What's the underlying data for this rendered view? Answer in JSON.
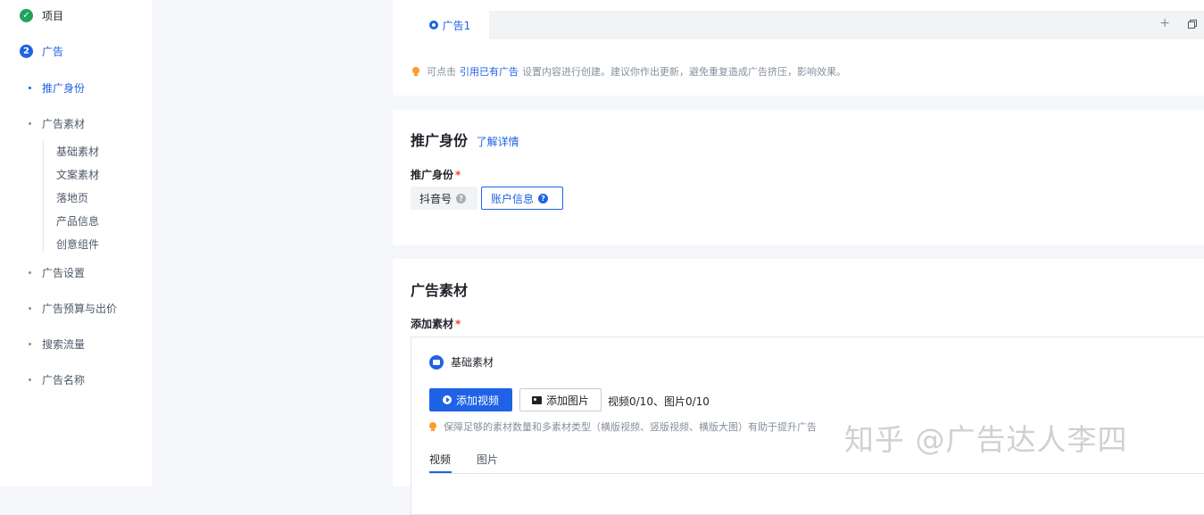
{
  "sidebar": {
    "steps": [
      {
        "label": "项目",
        "badge": "✓",
        "state": "done"
      },
      {
        "label": "广告",
        "badge": "2",
        "state": "current"
      }
    ],
    "nav": [
      {
        "label": "推广身份",
        "active": true
      },
      {
        "label": "广告素材",
        "active": false
      },
      {
        "label": "广告设置",
        "active": false
      },
      {
        "label": "广告预算与出价",
        "active": false
      },
      {
        "label": "搜索流量",
        "active": false
      },
      {
        "label": "广告名称",
        "active": false
      }
    ],
    "sub_items": [
      "基础素材",
      "文案素材",
      "落地页",
      "产品信息",
      "创意组件"
    ]
  },
  "ad_tabs": {
    "tabs": [
      {
        "label": "广告1"
      }
    ],
    "add_icon": "plus-icon",
    "copy_icon": "copy-icon",
    "tip_prefix": "可点击",
    "tip_link": "引用已有广告",
    "tip_suffix": "设置内容进行创建。建议你作出更新，避免重复造成广告挤压，影响效果。"
  },
  "identity": {
    "title": "推广身份",
    "learn_more": "了解详情",
    "field_label": "推广身份",
    "options": [
      {
        "label": "抖音号",
        "selected": false
      },
      {
        "label": "账户信息",
        "selected": true
      }
    ]
  },
  "material": {
    "title": "广告素材",
    "field_label": "添加素材",
    "basic_label": "基础素材",
    "add_video": "添加视频",
    "add_image": "添加图片",
    "count": "视频0/10、图片0/10",
    "tip": "保障足够的素材数量和多素材类型（横版视频、竖版视频、横版大图）有助于提升广告",
    "tabs": [
      {
        "label": "视频",
        "active": true
      },
      {
        "label": "图片",
        "active": false
      }
    ]
  },
  "watermark": "知乎 @广告达人李四",
  "colors": {
    "accent": "#1e62e6",
    "success": "#1fa35a",
    "required": "#f53f3f"
  }
}
